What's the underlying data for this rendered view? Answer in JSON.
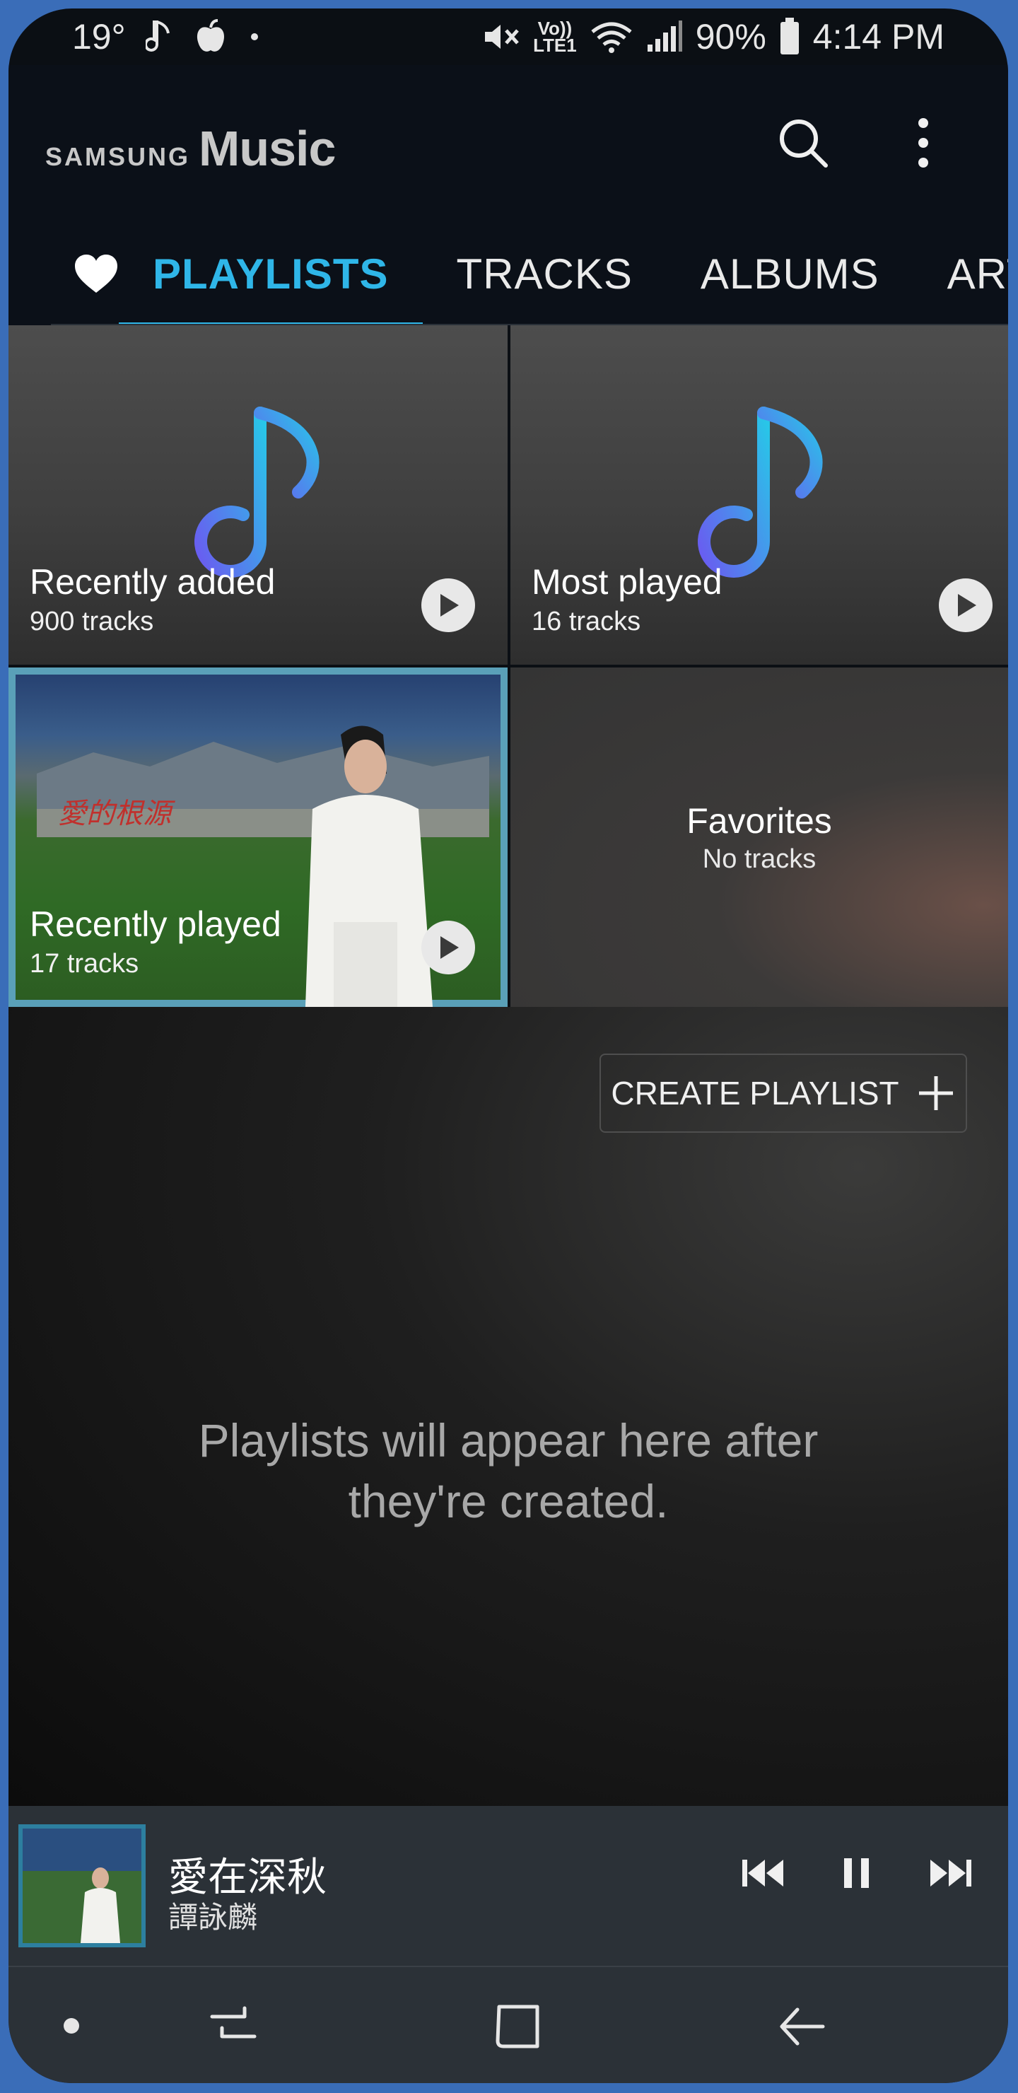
{
  "status_bar": {
    "temperature": "19°",
    "volte_label": "Vo))",
    "lte_label": "LTE1",
    "battery": "90%",
    "time": "4:14 PM"
  },
  "header": {
    "brand_prefix": "SAMSUNG",
    "brand_name": "Music"
  },
  "tabs": [
    {
      "label": "PLAYLISTS",
      "active": true
    },
    {
      "label": "TRACKS",
      "active": false
    },
    {
      "label": "ALBUMS",
      "active": false
    },
    {
      "label": "ARTISTS",
      "active": false
    }
  ],
  "playlists": [
    {
      "title": "Recently added",
      "subtitle": "900 tracks"
    },
    {
      "title": "Most played",
      "subtitle": "16 tracks"
    },
    {
      "title": "Recently played",
      "subtitle": "17 tracks"
    },
    {
      "title": "Favorites",
      "subtitle": "No tracks"
    }
  ],
  "create_playlist_label": "CREATE PLAYLIST",
  "empty_message_line1": "Playlists will appear here after",
  "empty_message_line2": "they're created.",
  "now_playing": {
    "title": "愛在深秋",
    "artist": "譚詠麟"
  },
  "colors": {
    "accent": "#2fb6e8",
    "background": "#0b1018",
    "mini_player": "#2b3137"
  },
  "icons": [
    "music-note-status-icon",
    "apple-icon",
    "mute-icon",
    "wifi-icon",
    "signal-icon",
    "battery-icon",
    "search-icon",
    "more-vert-icon",
    "heart-icon",
    "music-note-icon",
    "play-icon",
    "plus-icon",
    "previous-icon",
    "pause-icon",
    "next-icon",
    "recents-icon",
    "home-icon",
    "back-icon"
  ]
}
